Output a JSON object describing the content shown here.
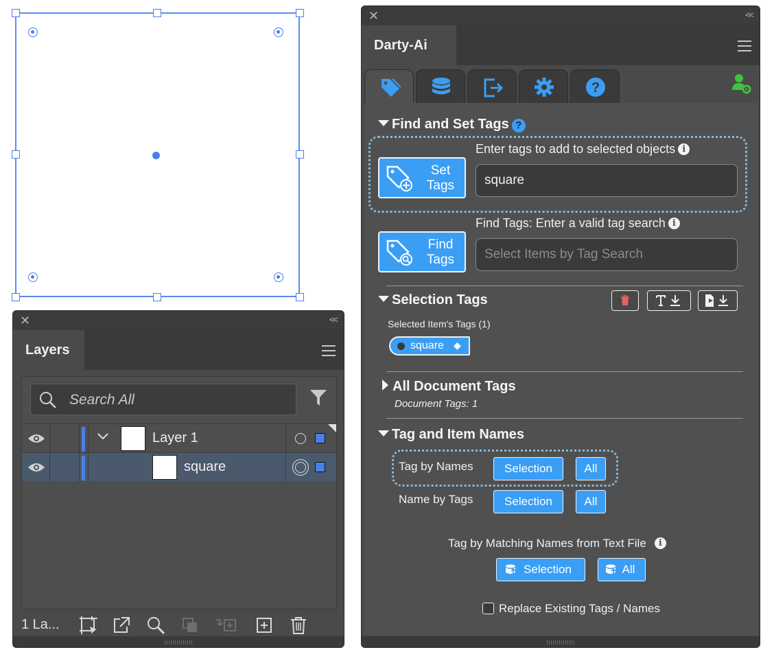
{
  "layers_panel": {
    "title": "Layers",
    "search_placeholder": "Search All",
    "rows": [
      {
        "name": "Layer 1"
      },
      {
        "name": "square"
      }
    ],
    "footer_count": "1 La..."
  },
  "darty_panel": {
    "title": "Darty-Ai",
    "tabs": [
      "tag-icon",
      "database-icon",
      "export-icon",
      "gear-icon",
      "help-icon"
    ],
    "find_set": {
      "title": "Find and Set Tags",
      "set_label": "Enter tags to add to selected objects",
      "set_button": [
        "Set",
        "Tags"
      ],
      "set_value": "square",
      "find_label": "Find Tags: Enter a valid tag search",
      "find_button": [
        "Find",
        "Tags"
      ],
      "find_placeholder": "Select Items by Tag Search"
    },
    "selection_tags": {
      "title": "Selection Tags",
      "subtitle": "Selected Item's Tags (1)",
      "chip": "square"
    },
    "all_document_tags": {
      "title": "All Document Tags",
      "subtitle": "Document Tags: 1"
    },
    "tag_item_names": {
      "title": "Tag and Item Names",
      "tag_by_names": "Tag by Names",
      "name_by_tags": "Name by Tags",
      "selection": "Selection",
      "all": "All",
      "text_file_label": "Tag by Matching Names from Text File",
      "replace_label": "Replace Existing Tags / Names"
    }
  },
  "colors": {
    "accent": "#3a9ef5",
    "selection": "#4a7fe8",
    "panel_bg": "#505050",
    "user_icon": "#3cc43c"
  }
}
